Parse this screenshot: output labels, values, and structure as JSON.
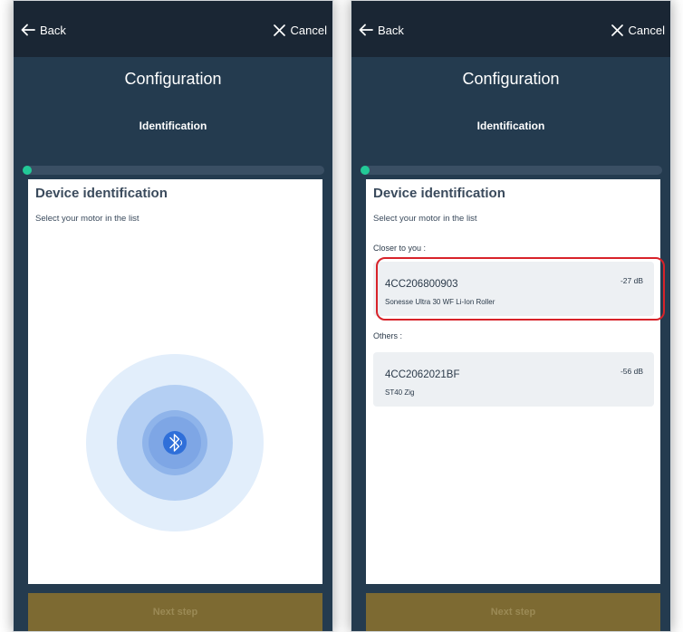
{
  "screens": [
    {
      "back_label": "Back",
      "cancel_label": "Cancel",
      "title": "Configuration",
      "subtitle": "Identification",
      "card_title": "Device identification",
      "card_hint": "Select your motor in the list",
      "next_label": "Next step"
    },
    {
      "back_label": "Back",
      "cancel_label": "Cancel",
      "title": "Configuration",
      "subtitle": "Identification",
      "card_title": "Device identification",
      "card_hint": "Select your motor in the list",
      "closer_label": "Closer to you :",
      "others_label": "Others :",
      "next_label": "Next step",
      "devices": [
        {
          "id": "4CC206800903",
          "model": "Sonesse Ultra 30 WF Li-Ion Roller",
          "signal": "-27 dB"
        },
        {
          "id": "4CC2062021BF",
          "model": "ST40 Zig",
          "signal": "-56 dB"
        }
      ]
    }
  ],
  "progress_fraction": 0.02,
  "icons": {
    "back": "arrow-left-icon",
    "cancel": "close-icon",
    "scan": "bluetooth-icon"
  },
  "colors": {
    "header": "#1a2634",
    "background": "#243b4f",
    "progress": "#22c997",
    "button": "#7d6a32",
    "highlight": "#d8232a",
    "bluetooth": "#2f6fd9"
  }
}
